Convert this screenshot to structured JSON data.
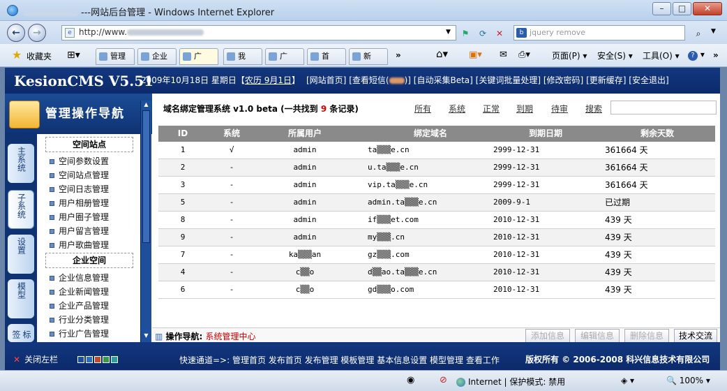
{
  "browser": {
    "title": "---网站后台管理 - Windows Internet Explorer",
    "address": "http://www.",
    "search_placeholder": "jquery remove",
    "favorites_label": "收藏夹",
    "commands": {
      "page": "页面(P)",
      "safety": "安全(S)",
      "tools": "工具(O)",
      "help": "?"
    },
    "status": {
      "zone": "Internet | 保护模式: 禁用",
      "zoom": "100%"
    }
  },
  "cms": {
    "logo": "KesionCMS V5.51",
    "date": "2009年10月18日 星期日【",
    "lunar": "农历 9月1日",
    "date_end": "】",
    "links": {
      "home": "[网站首页]",
      "sms": "[查看短信(",
      "sms_count": "",
      "sms_end": ")]",
      "collect": "[自动采集Beta]",
      "keywords": "[关键词批量处理]",
      "password": "[修改密码]",
      "cache": "[更新缓存]",
      "logout": "[安全退出]"
    }
  },
  "nav": {
    "title": "管理操作导航",
    "tabs": [
      "主系统",
      "子系统",
      "设置",
      "模型",
      "标签"
    ],
    "groups": [
      {
        "name": "空间站点",
        "items": [
          "空间参数设置",
          "空间站点管理",
          "空间日志管理",
          "用户相册管理",
          "用户圈子管理",
          "用户留言管理",
          "用户歌曲管理"
        ]
      },
      {
        "name": "企业空间",
        "items": [
          "企业信息管理",
          "企业新闻管理",
          "企业产品管理",
          "行业分类管理",
          "行业广告管理"
        ]
      }
    ]
  },
  "main": {
    "title": "域名绑定管理系统 v1.0 beta (一共找到",
    "count": "9",
    "title_end": "条记录)",
    "filters": [
      "所有",
      "系统",
      "正常",
      "到期",
      "待审",
      "搜索"
    ],
    "columns": [
      "ID",
      "系统",
      "所属用户",
      "绑定域名",
      "到期日期",
      "剩余天数"
    ],
    "rows": [
      {
        "id": "1",
        "sys": "√",
        "user": "admin",
        "domain": "ta▒▒▒e.cn",
        "date": "2999-12-31",
        "left": "361664 天"
      },
      {
        "id": "2",
        "sys": "-",
        "user": "admin",
        "domain": "u.ta▒▒▒e.cn",
        "date": "2999-12-31",
        "left": "361664 天"
      },
      {
        "id": "3",
        "sys": "-",
        "user": "admin",
        "domain": "vip.ta▒▒▒e.cn",
        "date": "2999-12-31",
        "left": "361664 天"
      },
      {
        "id": "5",
        "sys": "-",
        "user": "admin",
        "domain": "admin.ta▒▒▒e.cn",
        "date": "2009-9-1",
        "left": "已过期"
      },
      {
        "id": "8",
        "sys": "-",
        "user": "admin",
        "domain": "if▒▒▒et.com",
        "date": "2010-12-31",
        "left": "439 天"
      },
      {
        "id": "9",
        "sys": "-",
        "user": "admin",
        "domain": "my▒▒▒.cn",
        "date": "2010-12-31",
        "left": "439 天"
      },
      {
        "id": "7",
        "sys": "-",
        "user": "ka▒▒▒an",
        "domain": "gz▒▒▒.com",
        "date": "2010-12-31",
        "left": "439 天"
      },
      {
        "id": "4",
        "sys": "-",
        "user": "c▒▒o",
        "domain": "d▒▒ao.ta▒▒▒e.cn",
        "date": "2010-12-31",
        "left": "439 天"
      },
      {
        "id": "6",
        "sys": "-",
        "user": "c▒▒o",
        "domain": "gd▒▒▒o.com",
        "date": "2010-12-31",
        "left": "439 天"
      }
    ],
    "op_label": "操作导航:",
    "op_link": "系统管理中心",
    "buttons": {
      "add": "添加信息",
      "edit": "编辑信息",
      "delete": "删除信息",
      "support": "技术交流"
    }
  },
  "footer": {
    "close_left": "关闭左栏",
    "quicknav": "快速通道=>: 管理首页 发布首页 发布管理 模板管理 基本信息设置 模型管理 查看工作",
    "copyright": "版权所有 © 2006-2008 科兴信息技术有限公司"
  },
  "colors": {
    "brand_blue": "#0f3273",
    "table_header": "#8a8a8a",
    "accent_red": "#d00000"
  }
}
